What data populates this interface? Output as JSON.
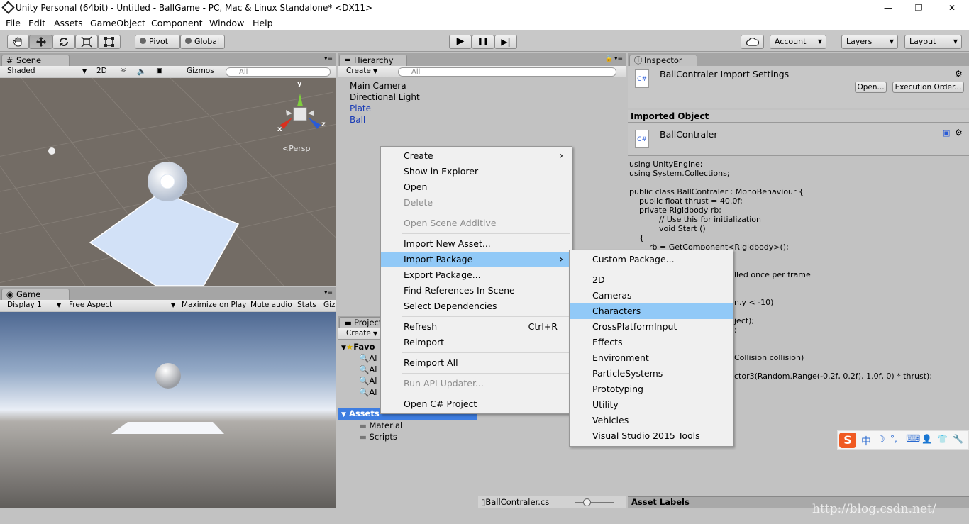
{
  "window": {
    "title": "Unity Personal (64bit) - Untitled - BallGame - PC, Mac & Linux Standalone* <DX11>",
    "minimize": "—",
    "restore": "❐",
    "close": "✕"
  },
  "menubar": [
    "File",
    "Edit",
    "Assets",
    "GameObject",
    "Component",
    "Window",
    "Help"
  ],
  "toolbar": {
    "pivot": "Pivot",
    "global": "Global",
    "account": "Account",
    "layers": "Layers",
    "layout": "Layout",
    "tool_icons": [
      "hand-icon",
      "move-icon",
      "rotate-icon",
      "scale-icon",
      "rect-icon"
    ],
    "play_icon": "▶",
    "pause_icon": "❚❚",
    "step_icon": "▶|"
  },
  "scene": {
    "tab": "Scene",
    "shading": "Shaded",
    "mode_2d": "2D",
    "gizmos": "Gizmos",
    "search_placeholder": "All",
    "persp": "Persp",
    "axis_y": "y",
    "axis_x": "x",
    "axis_z": "z"
  },
  "game": {
    "tab": "Game",
    "display": "Display 1",
    "aspect": "Free Aspect",
    "maximize": "Maximize on Play",
    "mute": "Mute audio",
    "stats": "Stats",
    "gizmos": "Giz"
  },
  "hierarchy": {
    "tab": "Hierarchy",
    "create": "Create",
    "search_placeholder": "All",
    "items": [
      {
        "label": "Main Camera",
        "color": "#000000"
      },
      {
        "label": "Directional Light",
        "color": "#000000"
      },
      {
        "label": "Plate",
        "color": "#1a3cb5"
      },
      {
        "label": "Ball",
        "color": "#1a3cb5"
      }
    ]
  },
  "project": {
    "tab": "Project",
    "create": "Create",
    "favorites": "Favo",
    "fav_items": [
      "Al",
      "Al",
      "Al",
      "Al"
    ],
    "assets": "Assets",
    "folders": [
      "Material",
      "Scripts"
    ],
    "file": "BallContraler.cs"
  },
  "inspector": {
    "tab": "Inspector",
    "title": "BallContraler Import Settings",
    "open": "Open...",
    "exec_order": "Execution Order...",
    "imported_object": "Imported Object",
    "object_name": "BallContraler",
    "asset_labels": "Asset Labels",
    "code": [
      "using UnityEngine;",
      "using System.Collections;",
      "",
      "public class BallContraler : MonoBehaviour {",
      "    public float thrust = 40.0f;",
      "    private Rigidbody rb;",
      "            // Use this for initialization",
      "            void Start ()",
      "    {",
      "        rb = GetComponent<Rigidbody>();"
    ],
    "code_fragments": [
      "lled once per frame",
      "n.y < -10)",
      "ject);",
      ";",
      "Collision collision)",
      "ctor3(Random.Range(-0.2f, 0.2f), 1.0f, 0) * thrust);"
    ]
  },
  "context_menu": {
    "items": [
      {
        "label": "Create",
        "arrow": "›"
      },
      {
        "label": "Show in Explorer"
      },
      {
        "label": "Open"
      },
      {
        "label": "Delete",
        "disabled": true
      },
      {
        "label": "Open Scene Additive",
        "disabled": true
      },
      {
        "label": "Import New Asset..."
      },
      {
        "label": "Import Package",
        "arrow": "›",
        "highlighted": true
      },
      {
        "label": "Export Package..."
      },
      {
        "label": "Find References In Scene"
      },
      {
        "label": "Select Dependencies"
      },
      {
        "label": "Refresh",
        "shortcut": "Ctrl+R"
      },
      {
        "label": "Reimport"
      },
      {
        "label": "Reimport All"
      },
      {
        "label": "Run API Updater...",
        "disabled": true
      },
      {
        "label": "Open C# Project"
      }
    ]
  },
  "submenu": {
    "items": [
      {
        "label": "Custom Package..."
      },
      {
        "label": "2D"
      },
      {
        "label": "Cameras"
      },
      {
        "label": "Characters",
        "highlighted": true
      },
      {
        "label": "CrossPlatformInput"
      },
      {
        "label": "Effects"
      },
      {
        "label": "Environment"
      },
      {
        "label": "ParticleSystems"
      },
      {
        "label": "Prototyping"
      },
      {
        "label": "Utility"
      },
      {
        "label": "Vehicles"
      },
      {
        "label": "Visual Studio 2015 Tools"
      }
    ]
  },
  "ime": {
    "logo": "S",
    "lang": "中",
    "moon": "☽",
    "punct": "°,",
    "keyboard": "⌨",
    "person": "👤",
    "shirt": "👕",
    "wrench": "🔧"
  },
  "watermark": "http://blog.csdn.net/",
  "colors": {
    "highlight": "#91c9f7",
    "link": "#1a3cb5",
    "scene_bg": "#736c65",
    "ime_orange": "#f05a22"
  }
}
